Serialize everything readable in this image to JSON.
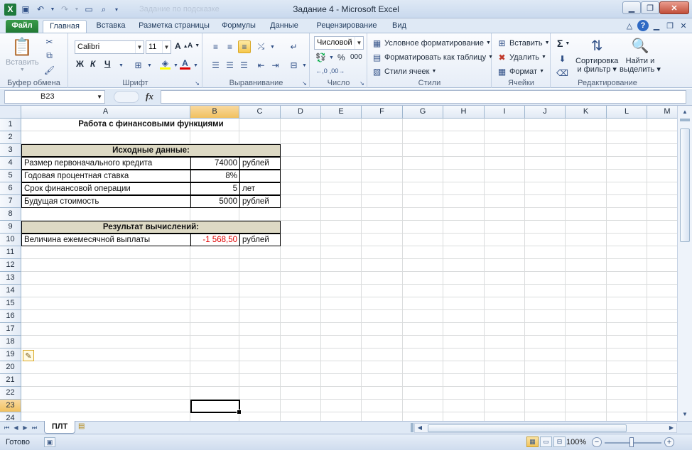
{
  "window": {
    "title": "Задание 4  -  Microsoft Excel",
    "app_icon": "excel-logo-icon",
    "quick_access_faint": "Задание по подсказке"
  },
  "tabs": [
    "Файл",
    "Главная",
    "Вставка",
    "Разметка страницы",
    "Формулы",
    "Данные",
    "Рецензирование",
    "Вид"
  ],
  "ribbon": {
    "clipboard": {
      "label": "Буфер обмена",
      "paste": "Вставить"
    },
    "font": {
      "label": "Шрифт",
      "name": "Calibri",
      "size": "11",
      "bold": "Ж",
      "italic": "К",
      "underline": "Ч",
      "grow": "A",
      "shrink": "A"
    },
    "alignment": {
      "label": "Выравнивание"
    },
    "number": {
      "label": "Число",
      "format": "Числовой",
      "percent": "%",
      "thousands": "000"
    },
    "styles": {
      "label": "Стили",
      "conditional": "Условное форматирование",
      "as_table": "Форматировать как таблицу",
      "cell_styles": "Стили ячеек"
    },
    "cells": {
      "label": "Ячейки",
      "insert": "Вставить",
      "delete": "Удалить",
      "format": "Формат"
    },
    "editing": {
      "label": "Редактирование",
      "sum": "Σ",
      "sort": "Сортировка",
      "sort2": "и фильтр",
      "find": "Найти и",
      "find2": "выделить"
    }
  },
  "formula_bar": {
    "name_box": "B23",
    "fx": "fx",
    "formula": ""
  },
  "columns": [
    "A",
    "B",
    "C",
    "D",
    "E",
    "F",
    "G",
    "H",
    "I",
    "J",
    "K",
    "L",
    "M"
  ],
  "rows": [
    "1",
    "2",
    "3",
    "4",
    "5",
    "6",
    "7",
    "8",
    "9",
    "10",
    "11",
    "12",
    "13",
    "14",
    "15",
    "16",
    "17",
    "18",
    "19",
    "20",
    "21",
    "22",
    "23",
    "24"
  ],
  "sheet": {
    "title": "Работа с финансовыми функциями",
    "source_header": "Исходные данные:",
    "rows": [
      {
        "label": "Размер первоначального кредита",
        "value": "74000",
        "unit": "рублей"
      },
      {
        "label": "Годовая процентная ставка",
        "value": "8%",
        "unit": ""
      },
      {
        "label": "Срок финансовой операции",
        "value": "5",
        "unit": "лет"
      },
      {
        "label": "Будущая стоимость",
        "value": "5000",
        "unit": "рублей"
      }
    ],
    "result_header": "Результат вычислений:",
    "result": {
      "label": "Величина ежемесячной выплаты",
      "value": "-1 568,50",
      "unit": "рублей"
    }
  },
  "selected_cell": "B23",
  "sheet_tabs": [
    "ПЛТ"
  ],
  "status": {
    "text": "Готово",
    "zoom": "100%"
  },
  "colors": {
    "header_fill": "#ddd9c4",
    "negative": "#e00000",
    "selection": "#f1c15f"
  }
}
